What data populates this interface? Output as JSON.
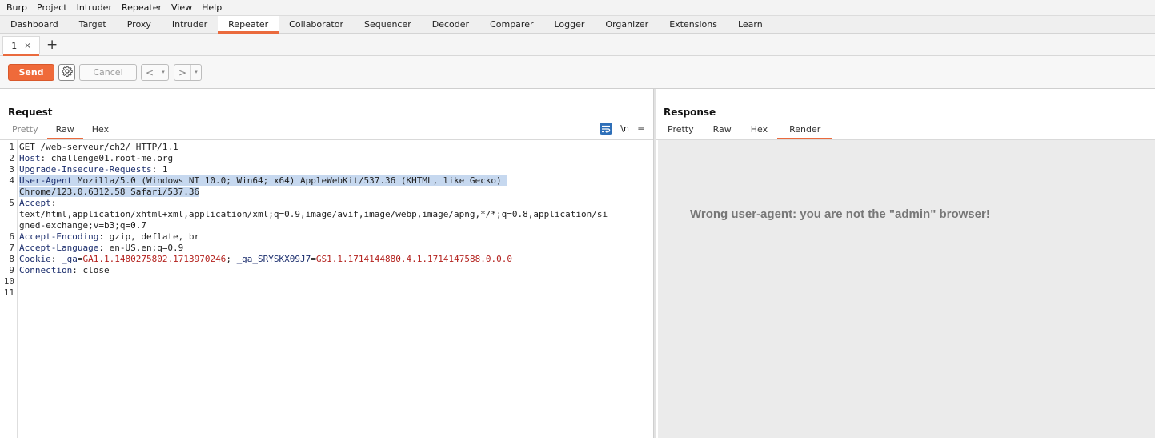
{
  "menu": [
    "Burp",
    "Project",
    "Intruder",
    "Repeater",
    "View",
    "Help"
  ],
  "tool_tabs": [
    "Dashboard",
    "Target",
    "Proxy",
    "Intruder",
    "Repeater",
    "Collaborator",
    "Sequencer",
    "Decoder",
    "Comparer",
    "Logger",
    "Organizer",
    "Extensions",
    "Learn"
  ],
  "active_tool_tab": "Repeater",
  "repeater_tab": {
    "label": "1",
    "close": "×"
  },
  "add_tab": "+",
  "toolbar": {
    "send": "Send",
    "cancel": "Cancel",
    "back": "<",
    "forward": ">",
    "dropdown": "▾"
  },
  "request": {
    "title": "Request",
    "tabs": [
      "Pretty",
      "Raw",
      "Hex"
    ],
    "active_tab": "Raw",
    "icons": [
      "wrap-lines-icon",
      "newline-icon",
      "menu-icon"
    ],
    "newline_label": "\\n",
    "line_numbers": [
      "1",
      "2",
      "3",
      "4",
      "5",
      "6",
      "7",
      "8",
      "9",
      "10",
      "11"
    ],
    "lines": {
      "l1": "GET /web-serveur/ch2/ HTTP/1.1",
      "l2_key": "Host",
      "l2_val": ": challenge01.root-me.org",
      "l3_key": "Upgrade-Insecure-Requests",
      "l3_val": ": 1",
      "l4_key": "User-Agent",
      "l4_val_a": ": ",
      "l4_val_b": " Mozilla/5.0 (Windows NT 10.0; Win64; x64) AppleWebKit/537.36 (KHTML, like Gecko) ",
      "l4_cont": "Chrome/123.0.6312.58 Safari/537.36",
      "l5_key": "Accept",
      "l5_val": ":",
      "l5_cont1": "text/html,application/xhtml+xml,application/xml;q=0.9,image/avif,image/webp,image/apng,*/*;q=0.8,application/si",
      "l5_cont2": "gned-exchange;v=b3;q=0.7",
      "l6_key": "Accept-Encoding",
      "l6_val": ": gzip, deflate, br",
      "l7_key": "Accept-Language",
      "l7_val": ": en-US,en;q=0.9",
      "l8_key": "Cookie",
      "l8_sep": ": ",
      "l8_c1k": "_ga",
      "l8_eq": "=",
      "l8_c1v": "GA1.1.1480275802.1713970246",
      "l8_semi": "; ",
      "l8_c2k": "_ga_SRYSKX09J7",
      "l8_c2v": "GS1.1.1714144880.4.1.1714147588.0.0.0",
      "l9_key": "Connection",
      "l9_val": ": close"
    }
  },
  "response": {
    "title": "Response",
    "tabs": [
      "Pretty",
      "Raw",
      "Hex",
      "Render"
    ],
    "active_tab": "Render",
    "rendered_text": "Wrong user-agent: you are not the \"admin\" browser!"
  },
  "colors": {
    "accent": "#ea6a3d",
    "send_button": "#ef6a3a",
    "header_key": "#1d2f6e",
    "cookie_value": "#b4231f",
    "selection": "#c6d8ef",
    "render_bg": "#ebebeb"
  }
}
